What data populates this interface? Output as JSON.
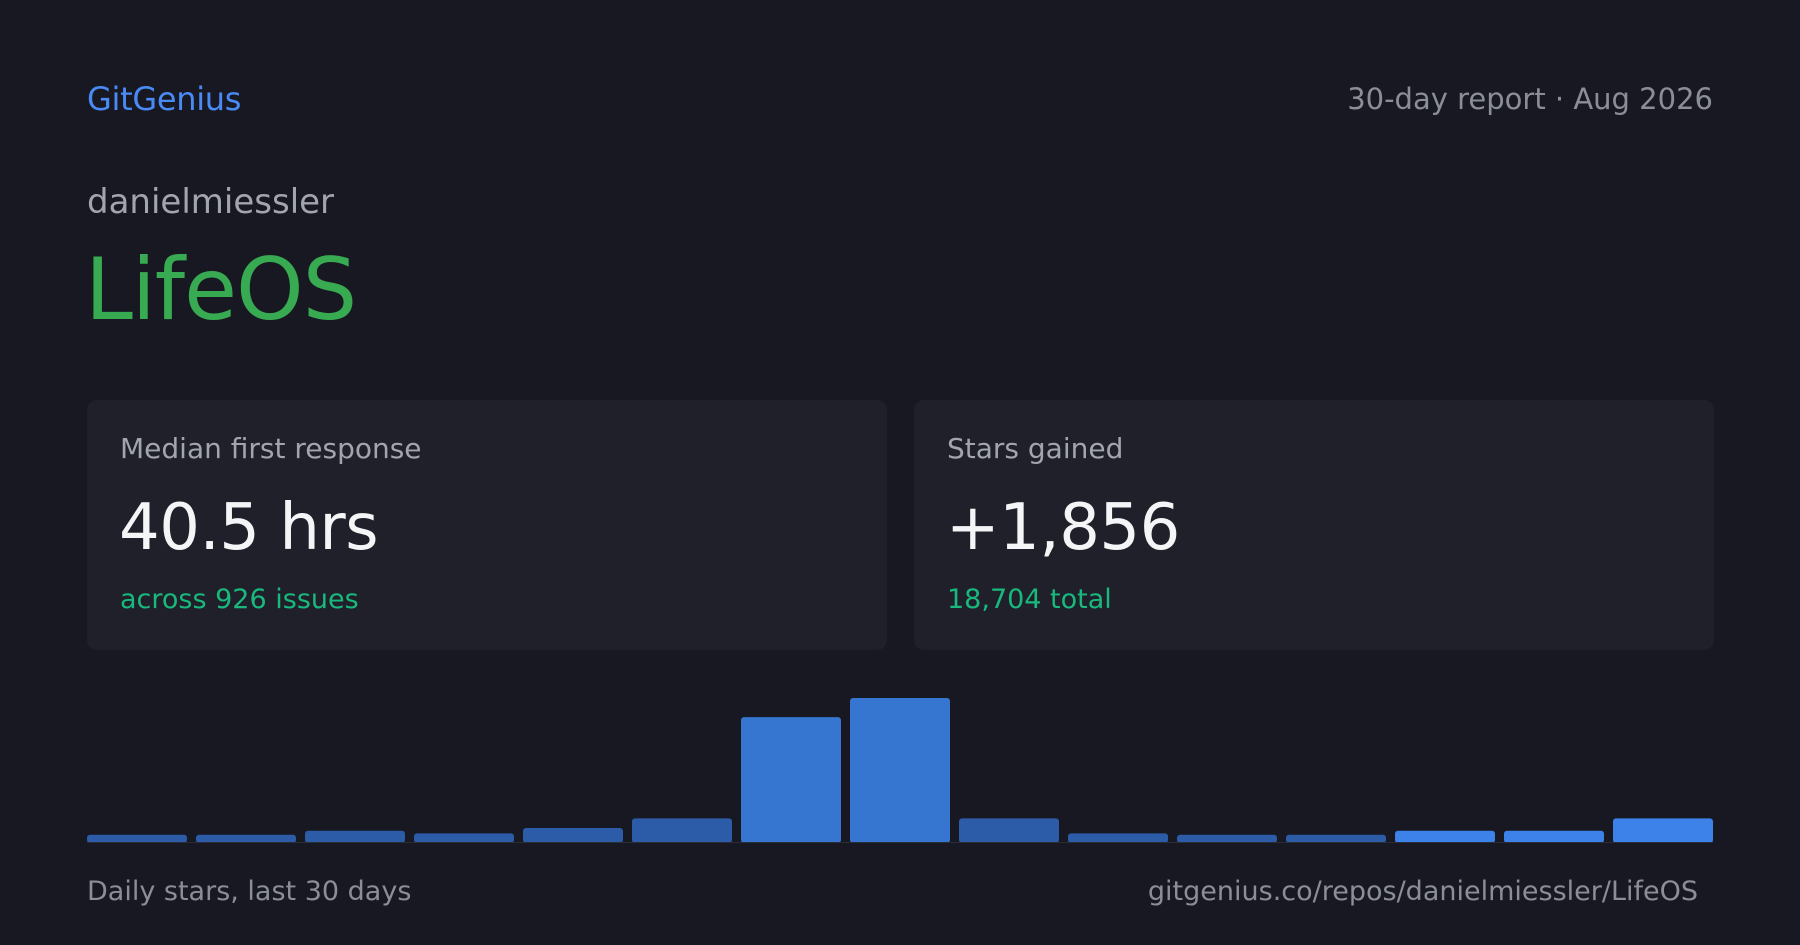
{
  "header": {
    "brand": "GitGenius",
    "report": "30-day report · Aug 2026"
  },
  "repo": {
    "owner": "danielmiessler",
    "name": "LifeOS"
  },
  "cards": [
    {
      "label": "Median first response",
      "value": "40.5 hrs",
      "sub": "across 926 issues"
    },
    {
      "label": "Stars gained",
      "value": "+1,856",
      "sub": "18,704 total"
    }
  ],
  "footer": {
    "caption": "Daily stars, last 30 days",
    "link": "gitgenius.co/repos/danielmiessler/LifeOS"
  },
  "colors": {
    "background": "#171821",
    "brand": "#4a8af4",
    "repo_name": "#38ab52",
    "positive": "#19b87d",
    "bar_muted": "#2c5ba8",
    "bar_peak": "#3676d0",
    "bar_recent": "#3d82e8"
  },
  "chart_data": {
    "type": "bar",
    "title": "",
    "xlabel": "",
    "ylabel": "",
    "grid": false,
    "bars": 15,
    "values": [
      6,
      6,
      9,
      7,
      11,
      18,
      92,
      106,
      18,
      7,
      6,
      6,
      9,
      9,
      18
    ],
    "ylim": [
      0,
      106
    ]
  }
}
